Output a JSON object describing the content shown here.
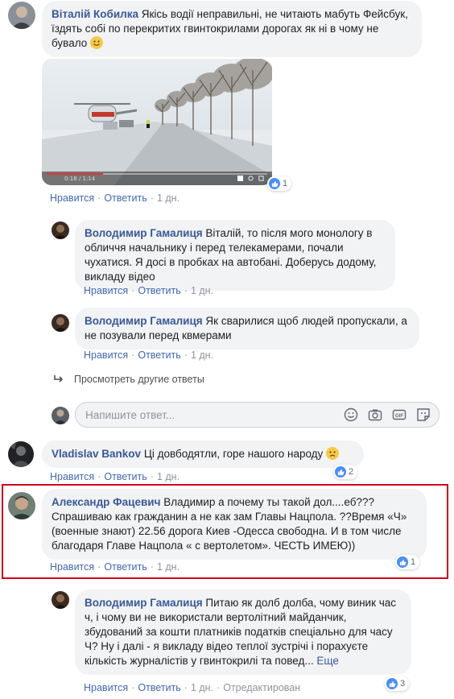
{
  "comments": {
    "c1": {
      "author": "Віталій Кобилка",
      "text": "Якісь водії неправильні, не читають мабуть Фейсбук, їздять собі по перекритих гвинтокрилами дорогах як ні в чому не бувало",
      "like": "Нравится",
      "reply": "Ответить",
      "time": "1 дн.",
      "reactions": "1",
      "video_time": "0:18 / 1:14"
    },
    "r1": {
      "author": "Володимир Гамалиця",
      "text": "Віталій, то після мого монологу в обличчя начальнику і перед телекамерами, почали чухатися. Я досі в пробках на автобані. Доберусь додому, викладу відео",
      "like": "Нравится",
      "reply": "Ответить",
      "time": "1 дн."
    },
    "r2": {
      "author": "Володимир Гамалиця",
      "text": "Як сварилися щоб людей пропускали, а не позували перед квмерами",
      "like": "Нравится",
      "reply": "Ответить",
      "time": "1 дн."
    },
    "more_replies": "Просмотреть другие ответы",
    "reply_box": {
      "placeholder": "Напишите ответ..."
    },
    "c2": {
      "author": "Vladislav Bankov",
      "text": "Ці довбодятли, горе нашого народу",
      "like": "Нравится",
      "reply": "Ответить",
      "time": "1 дн.",
      "reactions": "2"
    },
    "c3": {
      "author": "Александр Фацевич",
      "text": "Владимир а почему ты такой дол....еб??? Спрашиваю как гражданин а не как зам Главы Нацпола. ??Время «Ч» (военные знают) 22.56 дорога Киев -Одесса свободна. И в том числе благодаря Главе Нацпола « с вертолетом». ЧЕСТЬ ИМЕЮ))",
      "like": "Нравится",
      "reply": "Ответить",
      "time": "1 дн.",
      "reactions": "1",
      "highlight_color": "#d0021b"
    },
    "r3": {
      "author": "Володимир Гамалиця",
      "text": "Питаю як долб долба, чому виник час ч, і чому ви не використали вертолітний майданчик, збудований за кошти платників податків спеціально для часу Ч? Ну і далі - я викладу відео теплої зустрічі і порахуєте кількість журналістів у гвинтокрилі та повед...",
      "more": "Еще",
      "like": "Нравится",
      "reply": "Ответить",
      "time": "1 дн.",
      "edited": "Отредактирован",
      "reactions": "3"
    }
  },
  "colors": {
    "link": "#385898",
    "bubble": "#f2f3f5",
    "like_blue": "#4a8df8",
    "highlight": "#d0021b"
  }
}
